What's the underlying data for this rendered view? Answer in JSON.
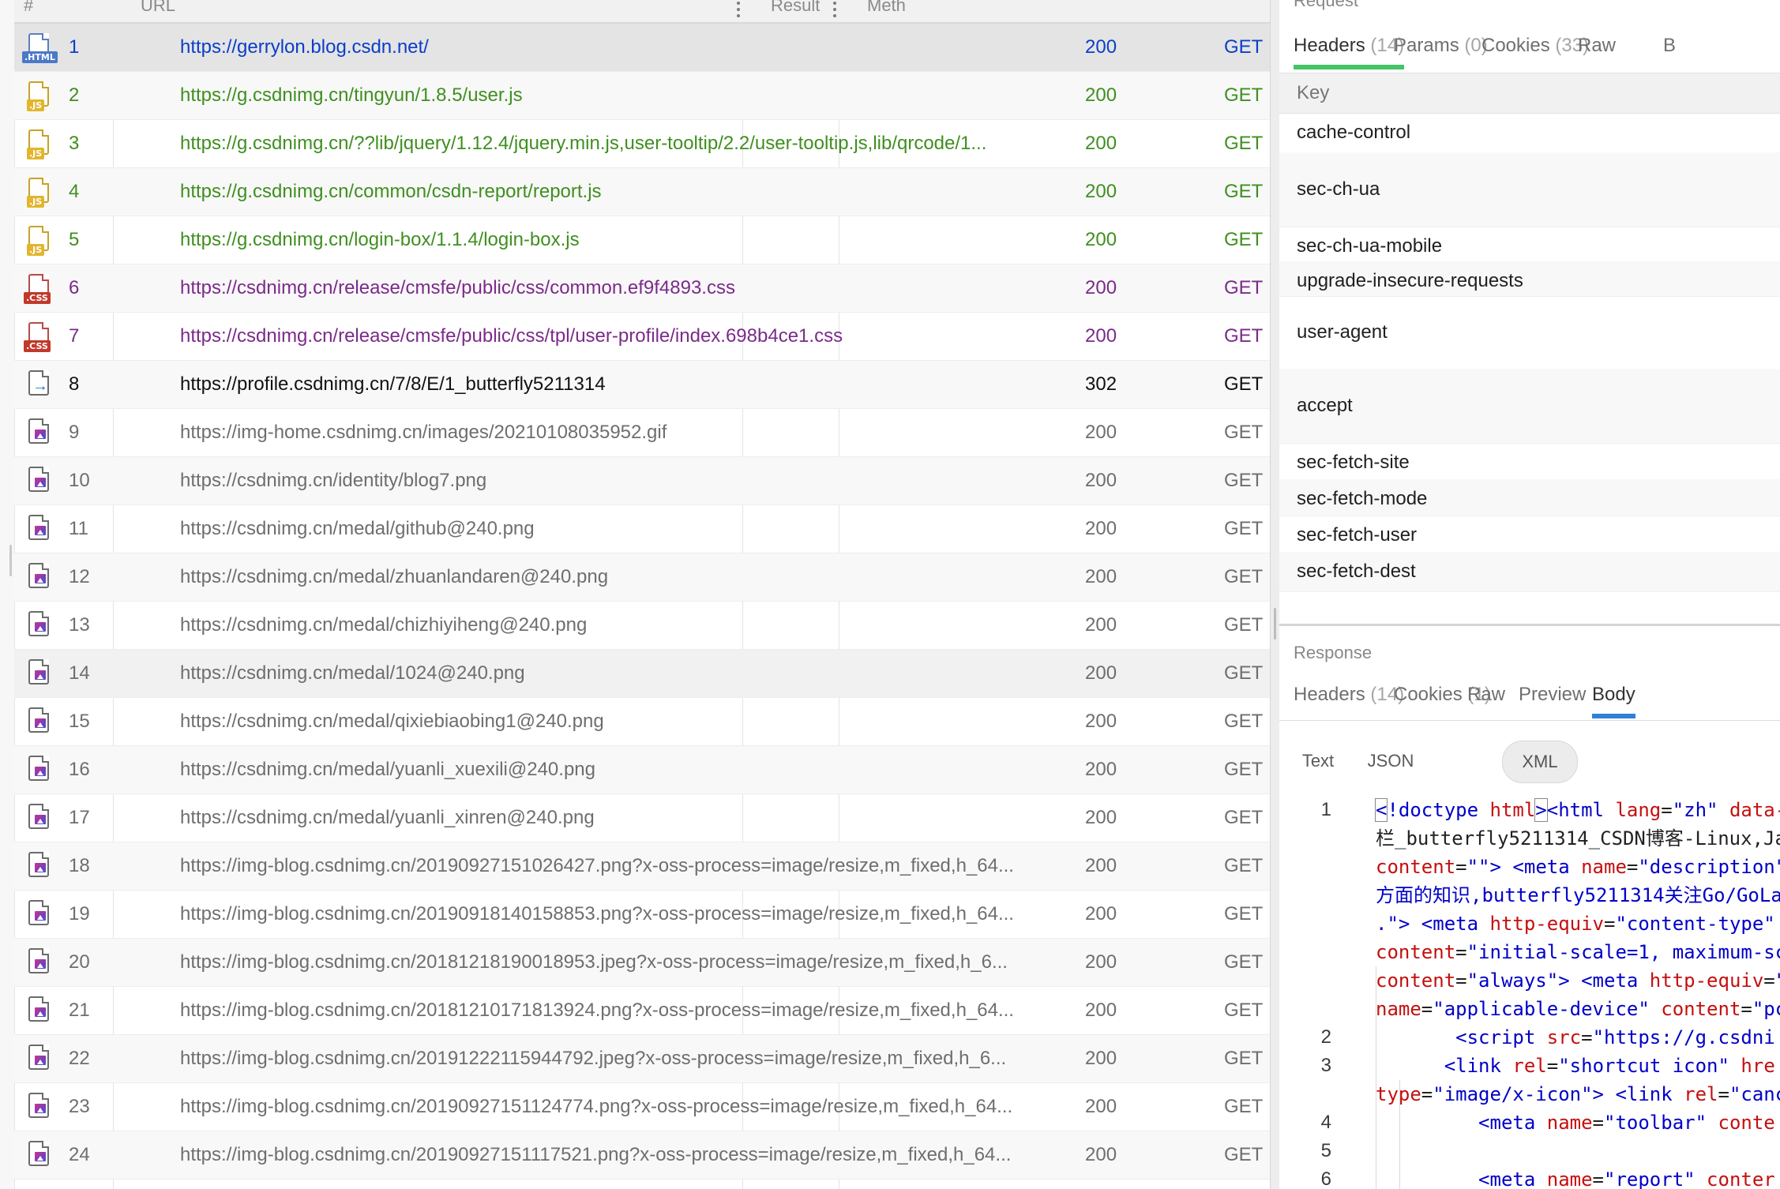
{
  "colors": {
    "html_link": "#0b3ec9",
    "js_link": "#3f8f1f",
    "css_link": "#7b2a8a",
    "redirect_text": "#111111",
    "image_text": "#6e6e6e",
    "tab_underline_green": "#43c465",
    "tab_underline_blue": "#2f80d6"
  },
  "sessions": {
    "columns": {
      "number": "#",
      "url": "URL",
      "result": "Result",
      "method": "Meth"
    },
    "rows": [
      {
        "num": "1",
        "type": "html",
        "url": "https://gerrylon.blog.csdn.net/",
        "result": "200",
        "method": "GET"
      },
      {
        "num": "2",
        "type": "js",
        "url": "https://g.csdnimg.cn/tingyun/1.8.5/user.js",
        "result": "200",
        "method": "GET"
      },
      {
        "num": "3",
        "type": "js",
        "url": "https://g.csdnimg.cn/??lib/jquery/1.12.4/jquery.min.js,user-tooltip/2.2/user-tooltip.js,lib/qrcode/1...",
        "result": "200",
        "method": "GET"
      },
      {
        "num": "4",
        "type": "js",
        "url": "https://g.csdnimg.cn/common/csdn-report/report.js",
        "result": "200",
        "method": "GET"
      },
      {
        "num": "5",
        "type": "js",
        "url": "https://g.csdnimg.cn/login-box/1.1.4/login-box.js",
        "result": "200",
        "method": "GET"
      },
      {
        "num": "6",
        "type": "css",
        "url": "https://csdnimg.cn/release/cmsfe/public/css/common.ef9f4893.css",
        "result": "200",
        "method": "GET"
      },
      {
        "num": "7",
        "type": "css",
        "url": "https://csdnimg.cn/release/cmsfe/public/css/tpl/user-profile/index.698b4ce1.css",
        "result": "200",
        "method": "GET"
      },
      {
        "num": "8",
        "type": "redirect",
        "url": "https://profile.csdnimg.cn/7/8/E/1_butterfly5211314",
        "result": "302",
        "method": "GET"
      },
      {
        "num": "9",
        "type": "image",
        "url": "https://img-home.csdnimg.cn/images/20210108035952.gif",
        "result": "200",
        "method": "GET"
      },
      {
        "num": "10",
        "type": "image",
        "url": "https://csdnimg.cn/identity/blog7.png",
        "result": "200",
        "method": "GET"
      },
      {
        "num": "11",
        "type": "image",
        "url": "https://csdnimg.cn/medal/github@240.png",
        "result": "200",
        "method": "GET"
      },
      {
        "num": "12",
        "type": "image",
        "url": "https://csdnimg.cn/medal/zhuanlandaren@240.png",
        "result": "200",
        "method": "GET"
      },
      {
        "num": "13",
        "type": "image",
        "url": "https://csdnimg.cn/medal/chizhiyiheng@240.png",
        "result": "200",
        "method": "GET"
      },
      {
        "num": "14",
        "type": "image",
        "url": "https://csdnimg.cn/medal/1024@240.png",
        "result": "200",
        "method": "GET"
      },
      {
        "num": "15",
        "type": "image",
        "url": "https://csdnimg.cn/medal/qixiebiaobing1@240.png",
        "result": "200",
        "method": "GET"
      },
      {
        "num": "16",
        "type": "image",
        "url": "https://csdnimg.cn/medal/yuanli_xuexili@240.png",
        "result": "200",
        "method": "GET"
      },
      {
        "num": "17",
        "type": "image",
        "url": "https://csdnimg.cn/medal/yuanli_xinren@240.png",
        "result": "200",
        "method": "GET"
      },
      {
        "num": "18",
        "type": "image",
        "url": "https://img-blog.csdnimg.cn/20190927151026427.png?x-oss-process=image/resize,m_fixed,h_64...",
        "result": "200",
        "method": "GET"
      },
      {
        "num": "19",
        "type": "image",
        "url": "https://img-blog.csdnimg.cn/20190918140158853.png?x-oss-process=image/resize,m_fixed,h_64...",
        "result": "200",
        "method": "GET"
      },
      {
        "num": "20",
        "type": "image",
        "url": "https://img-blog.csdnimg.cn/20181218190018953.jpeg?x-oss-process=image/resize,m_fixed,h_6...",
        "result": "200",
        "method": "GET"
      },
      {
        "num": "21",
        "type": "image",
        "url": "https://img-blog.csdnimg.cn/20181210171813924.png?x-oss-process=image/resize,m_fixed,h_64...",
        "result": "200",
        "method": "GET"
      },
      {
        "num": "22",
        "type": "image",
        "url": "https://img-blog.csdnimg.cn/20191222115944792.jpeg?x-oss-process=image/resize,m_fixed,h_6...",
        "result": "200",
        "method": "GET"
      },
      {
        "num": "23",
        "type": "image",
        "url": "https://img-blog.csdnimg.cn/20190927151124774.png?x-oss-process=image/resize,m_fixed,h_64...",
        "result": "200",
        "method": "GET"
      },
      {
        "num": "24",
        "type": "image",
        "url": "https://img-blog.csdnimg.cn/20190927151117521.png?x-oss-process=image/resize,m_fixed,h_64...",
        "result": "200",
        "method": "GET"
      },
      {
        "num": "25",
        "type": "image",
        "url": "https://img-blog.csdnimg.cn/20190127115806858.png?x-oss-process=image/resize,m_fixed,h_64...",
        "result": "200",
        "method": "GET"
      }
    ]
  },
  "request": {
    "label": "Request",
    "tabs": [
      {
        "label": "Headers",
        "count": "(14)"
      },
      {
        "label": "Params",
        "count": "(0)"
      },
      {
        "label": "Cookies",
        "count": "(33)"
      },
      {
        "label": "Raw",
        "count": ""
      },
      {
        "label": "B",
        "count": ""
      }
    ],
    "headers_column": "Key",
    "header_keys": [
      "cache-control",
      "sec-ch-ua",
      "sec-ch-ua-mobile",
      "upgrade-insecure-requests",
      "user-agent",
      "accept",
      "sec-fetch-site",
      "sec-fetch-mode",
      "sec-fetch-user",
      "sec-fetch-dest"
    ]
  },
  "response": {
    "label": "Response",
    "tabs": [
      {
        "label": "Headers",
        "count": "(14)"
      },
      {
        "label": "Cookies",
        "count": "(1)"
      },
      {
        "label": "Raw",
        "count": ""
      },
      {
        "label": "Preview",
        "count": ""
      },
      {
        "label": "Body",
        "count": ""
      }
    ],
    "body_formats": [
      "Text",
      "JSON",
      "XML"
    ],
    "selected_format": "XML",
    "code_lines": [
      {
        "ln": "1",
        "html": "<span class=\"t-doctype cursor-box\">&lt;</span><span class=\"t-doctype\">!doctype </span><span class=\"t-attr\">html</span><span class=\"t-doctype cursor-box\">&gt;</span><span class=\"t-tag\">&lt;html </span><span class=\"t-attr\">lang</span>=<span class=\"t-val\">\"zh\"</span> <span class=\"t-attr\">data-</span>"
      },
      {
        "ln": "",
        "html": "<span class=\"t-eq\">栏_butterfly5211314_CSDN博客-Linux,Ja</span>"
      },
      {
        "ln": "",
        "html": "<span class=\"t-attr\">content</span>=<span class=\"t-val\">\"\"</span><span class=\"t-tag\">&gt; &lt;meta </span><span class=\"t-attr\">name</span>=<span class=\"t-val\">\"description\"</span>"
      },
      {
        "ln": "",
        "html": "<span class=\"t-text\">方面的知识,butterfly5211314关注Go/GoLa</span>"
      },
      {
        "ln": "",
        "html": "<span class=\"t-text\">.\"</span><span class=\"t-tag\">&gt; &lt;meta </span><span class=\"t-attr\">http-equiv</span>=<span class=\"t-val\">\"content-type\"</span> "
      },
      {
        "ln": "",
        "html": "<span class=\"t-attr\">content</span>=<span class=\"t-val\">\"initial-scale=1, maximum-sc</span>"
      },
      {
        "ln": "",
        "html": "<span class=\"t-attr\">content</span>=<span class=\"t-val\">\"always\"</span><span class=\"t-tag\">&gt; &lt;meta </span><span class=\"t-attr\">http-equiv</span>=<span class=\"t-val\">\"</span>"
      },
      {
        "ln": "",
        "html": "<span class=\"t-attr\">name</span>=<span class=\"t-val\">\"applicable-device\"</span> <span class=\"t-attr\">content</span>=<span class=\"t-val\">\"pc</span>"
      },
      {
        "ln": "2",
        "html": "       <span class=\"t-tag\">&lt;script </span><span class=\"t-attr\">src</span>=<span class=\"t-val\">\"https://g.csdni</span>"
      },
      {
        "ln": "3",
        "html": "      <span class=\"t-tag\">&lt;link </span><span class=\"t-attr\">rel</span>=<span class=\"t-val\">\"shortcut icon\"</span> <span class=\"t-attr\">hre</span>"
      },
      {
        "ln": "",
        "html": "<span class=\"t-attr\">type</span>=<span class=\"t-val\">\"image/x-icon\"</span><span class=\"t-tag\">&gt; &lt;link </span><span class=\"t-attr\">rel</span>=<span class=\"t-val\">\"canc</span>"
      },
      {
        "ln": "4",
        "html": "         <span class=\"t-tag\">&lt;meta </span><span class=\"t-attr\">name</span>=<span class=\"t-val\">\"toolbar\"</span> <span class=\"t-attr\">conte</span>"
      },
      {
        "ln": "5",
        "html": ""
      },
      {
        "ln": "6",
        "html": "         <span class=\"t-tag\">&lt;meta </span><span class=\"t-attr\">name</span>=<span class=\"t-val\">\"report\"</span> <span class=\"t-attr\">conter</span>"
      }
    ]
  }
}
